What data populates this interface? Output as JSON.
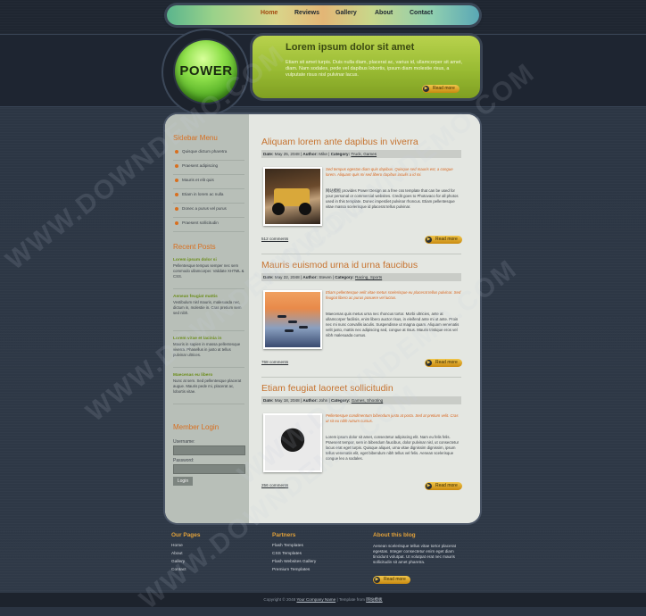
{
  "nav": {
    "items": [
      "Home",
      "Reviews",
      "Gallery",
      "About",
      "Contact"
    ],
    "active": "Home"
  },
  "logo": {
    "text": "POWER"
  },
  "banner": {
    "title": "Lorem ipsum dolor sit amet",
    "text": "Etiam sit amet turpis. Duis nulla diam, placerat ac, varius id, ullamcorper sit amet, diam. Nam sodales, pede vel dapibus lobortis, ipsum diam molestie risus, a vulputate risus nisl pulvinar lacus.",
    "button": "Read more"
  },
  "sidebar": {
    "menu_title": "Sidebar Menu",
    "menu": [
      "Quisque dictum pharetra",
      "Praesent adipiscing",
      "Mauris et elit quis",
      "Etiam in lorem ac nulla",
      "Donec a purus vel purus",
      "Praesent sollicitudin"
    ],
    "recent_title": "Recent Posts",
    "recent": [
      {
        "title": "Lorem ipsum dolor si",
        "text": "Pellentesque tempus semper nec sem commodo ullamcorper. Validate XHTML & CSS."
      },
      {
        "title": "Aenean feugiat mattis",
        "text": "Vestibulum nisl mauris, malesuada nec, dictum in, molestie in. Cras pretium sem sed nibh."
      },
      {
        "title": "Lorem vitae et lacinia in",
        "text": "Mauris in sapien in massa pellentesque viverra. Phasellus in justo at tellus pulvinar ultrices."
      },
      {
        "title": "Maecenas eu libero",
        "text": "Nunc at sem. Sed pellentesque placerat augue. Mauris pede mi, placerat ac, lobortis vitae."
      }
    ],
    "member_title": "Member Login",
    "username_label": "Username:",
    "password_label": "Password:",
    "login_button": "Login"
  },
  "articles": [
    {
      "title": "Aliquam lorem ante dapibus in viverra",
      "date": "May 25, 2048",
      "author": "Mike",
      "categories": "Truck, Games",
      "lead": "Sed tempus egestas diam quis dapibus. Quisque sed mauris est, a congue lorem. Aliquam quis mi sed libero dapibus iaculis a id mi.",
      "body": "网站模板 provides Power Design as a free css template that can be used for your personal or commercial websites. Credit goes to Photovaco for all photos used in this template. Donec imperdiet pulvinar rhoncus. Etiam pellentesque vitae massa scelerisque id placerat tellus pulvinar.",
      "comments": "512 comments",
      "button": "Read more"
    },
    {
      "title": "Mauris euismod urna id urna faucibus",
      "date": "May 22, 2048",
      "author": "Steven",
      "categories": "Racing, Sports",
      "lead": "Etiam pellentesque velit vitae metus scelerisque eu placerat tellus pulvinar. Sed feugiat libero ac purus posuere vel luctus.",
      "body": "Maecenas quis metus urna nec rhoncus tortor. Morbi ultricies, ante at ullamcorper facilisis, enim libero auctor risus, in eleifend ante mi ut ante. Proin nec mi nunc convallis iaculis. Suspendisse ut magna quam. Aliquam venenatis velit justo, mattis nec adipiscing sed, congue at risus. Mauris tristique eros vel nibh malesuada cursus.",
      "comments": "768 comments",
      "button": "Read more"
    },
    {
      "title": "Etiam feugiat laoreet sollicitudin",
      "date": "May 18, 2048",
      "author": "John",
      "categories": "Games, Shooting",
      "lead": "Pellentesque condimentum bibendum justo at porta. Sed at pretium velit. Cras ut sit eu nibh rutrum cursus.",
      "body": "Lorem ipsum dolor sit amet, consectetur adipiscing elit. Nam eu felis felis. Praesent tempor, sem in bibendum faucibus, dolor pulvinar nisl, ut consectetur lacus erat eget turpis. Quisque aliquet, urna vitae dignissim dignissim, ipsum tellus venenatis elit, eget bibendum nibh tellus vel felis. Aenean scelerisque congue leo a sodales.",
      "comments": "256 comments",
      "button": "Read more"
    }
  ],
  "meta_labels": {
    "date": "Date:",
    "author": "Author:",
    "category": "Category:"
  },
  "footer": {
    "pages_title": "Our Pages",
    "pages": [
      "Home",
      "About",
      "Gallery",
      "Contact"
    ],
    "partners_title": "Partners",
    "partners": [
      "Flash Templates",
      "CSS Templates",
      "Flash Websites Gallery",
      "Premium Templates"
    ],
    "about_title": "About this blog",
    "about_text": "Aenean scelerisque tellus vitae tortor placerat egestas. Integer consectetur enim eget diam tincidunt volutpat. Ut volutpat erat nec mauris sollicitudin sit amet pharetra.",
    "about_button": "Read more",
    "copyright_prefix": "Copyright © 2048",
    "company": "Your Company Name",
    "template_by_prefix": "| Template from",
    "template_by": "网站模板"
  },
  "watermark": "WWW.DOWNDEMO.COM"
}
